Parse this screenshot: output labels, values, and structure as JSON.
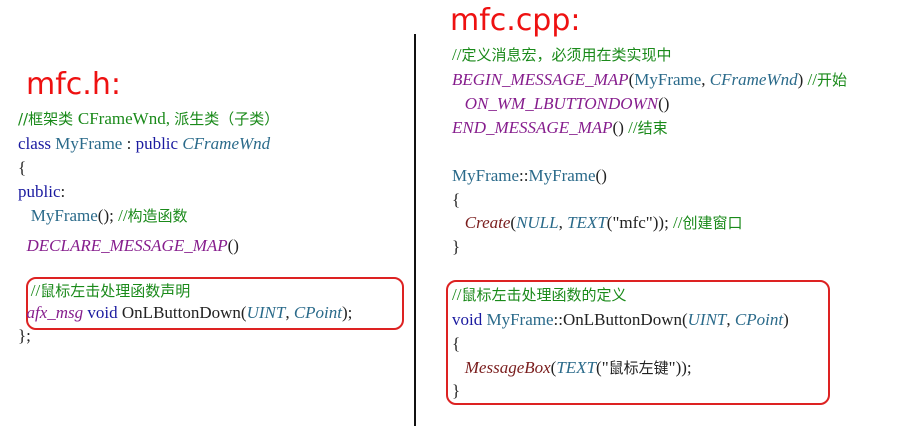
{
  "left": {
    "heading": "mfc.h:",
    "lines": [
      [
        {
          "t": "//框架类 ",
          "c": "comment cjk"
        },
        {
          "t": "CFrameWnd, ",
          "c": "comment"
        },
        {
          "t": "派生类（子类）",
          "c": "comment cjk"
        }
      ],
      [
        {
          "t": "class ",
          "c": "kw"
        },
        {
          "t": "MyFrame",
          "c": "type"
        },
        {
          "t": " : ",
          "c": "plain"
        },
        {
          "t": "public ",
          "c": "kw"
        },
        {
          "t": "CFrameWnd",
          "c": "cls"
        }
      ],
      [
        {
          "t": "{",
          "c": "plain"
        }
      ],
      [
        {
          "t": "public",
          "c": "kw"
        },
        {
          "t": ":",
          "c": "plain"
        }
      ],
      [
        {
          "t": "   MyFrame",
          "c": "type"
        },
        {
          "t": "(); ",
          "c": "plain"
        },
        {
          "t": "//",
          "c": "comment"
        },
        {
          "t": "构造函数",
          "c": "comment cjk"
        }
      ],
      [
        {
          "t": "  DECLARE_MESSAGE_MAP",
          "c": "macro"
        },
        {
          "t": "()",
          "c": "plain"
        }
      ],
      [
        {
          "t": "   //",
          "c": "comment"
        },
        {
          "t": "鼠标左击处理函数声明",
          "c": "comment cjk"
        }
      ],
      [
        {
          "t": "  afx_msg ",
          "c": "macro"
        },
        {
          "t": "void ",
          "c": "kw"
        },
        {
          "t": "OnLButtonDown",
          "c": "plain"
        },
        {
          "t": "(",
          "c": "plain"
        },
        {
          "t": "UINT",
          "c": "cls"
        },
        {
          "t": ", ",
          "c": "plain"
        },
        {
          "t": "CPoint",
          "c": "cls"
        },
        {
          "t": ");",
          "c": "plain"
        }
      ],
      [
        {
          "t": "};",
          "c": "plain"
        }
      ]
    ]
  },
  "right": {
    "heading": "mfc.cpp:",
    "lines": [
      [
        {
          "t": "//",
          "c": "comment"
        },
        {
          "t": "定义消息宏，必须用在类实现中",
          "c": "comment cjk"
        }
      ],
      [
        {
          "t": "BEGIN_MESSAGE_MAP",
          "c": "macro"
        },
        {
          "t": "(",
          "c": "plain"
        },
        {
          "t": "MyFrame",
          "c": "type"
        },
        {
          "t": ", ",
          "c": "plain"
        },
        {
          "t": "CFrameWnd",
          "c": "cls"
        },
        {
          "t": ") ",
          "c": "plain"
        },
        {
          "t": "//",
          "c": "comment"
        },
        {
          "t": "开始",
          "c": "comment cjk"
        }
      ],
      [
        {
          "t": "   ON_WM_LBUTTONDOWN",
          "c": "macro"
        },
        {
          "t": "()",
          "c": "plain"
        }
      ],
      [
        {
          "t": "END_MESSAGE_MAP",
          "c": "macro"
        },
        {
          "t": "() ",
          "c": "plain"
        },
        {
          "t": "//",
          "c": "comment"
        },
        {
          "t": "结束",
          "c": "comment cjk"
        }
      ],
      [
        {
          "t": "MyFrame",
          "c": "type"
        },
        {
          "t": "::",
          "c": "plain"
        },
        {
          "t": "MyFrame",
          "c": "type"
        },
        {
          "t": "()",
          "c": "plain"
        }
      ],
      [
        {
          "t": "{",
          "c": "plain"
        }
      ],
      [
        {
          "t": "   Create",
          "c": "func"
        },
        {
          "t": "(",
          "c": "plain"
        },
        {
          "t": "NULL",
          "c": "cls"
        },
        {
          "t": ", ",
          "c": "plain"
        },
        {
          "t": "TEXT",
          "c": "cls"
        },
        {
          "t": "(\"mfc\")); ",
          "c": "plain"
        },
        {
          "t": "//",
          "c": "comment"
        },
        {
          "t": "创建窗口",
          "c": "comment cjk"
        }
      ],
      [
        {
          "t": "}",
          "c": "plain"
        }
      ],
      [
        {
          "t": "//",
          "c": "comment"
        },
        {
          "t": "鼠标左击处理函数的定义",
          "c": "comment cjk"
        }
      ],
      [
        {
          "t": "void ",
          "c": "kw"
        },
        {
          "t": "MyFrame",
          "c": "type"
        },
        {
          "t": "::",
          "c": "plain"
        },
        {
          "t": "OnLButtonDown",
          "c": "plain"
        },
        {
          "t": "(",
          "c": "plain"
        },
        {
          "t": "UINT",
          "c": "cls"
        },
        {
          "t": ", ",
          "c": "plain"
        },
        {
          "t": "CPoint",
          "c": "cls"
        },
        {
          "t": ")",
          "c": "plain"
        }
      ],
      [
        {
          "t": "{",
          "c": "plain"
        }
      ],
      [
        {
          "t": "   MessageBox",
          "c": "func"
        },
        {
          "t": "(",
          "c": "plain"
        },
        {
          "t": "TEXT",
          "c": "cls"
        },
        {
          "t": "(\"",
          "c": "plain"
        },
        {
          "t": "鼠标左键",
          "c": "plain cjk"
        },
        {
          "t": "\"));",
          "c": "plain"
        }
      ],
      [
        {
          "t": "}",
          "c": "plain"
        }
      ]
    ]
  }
}
